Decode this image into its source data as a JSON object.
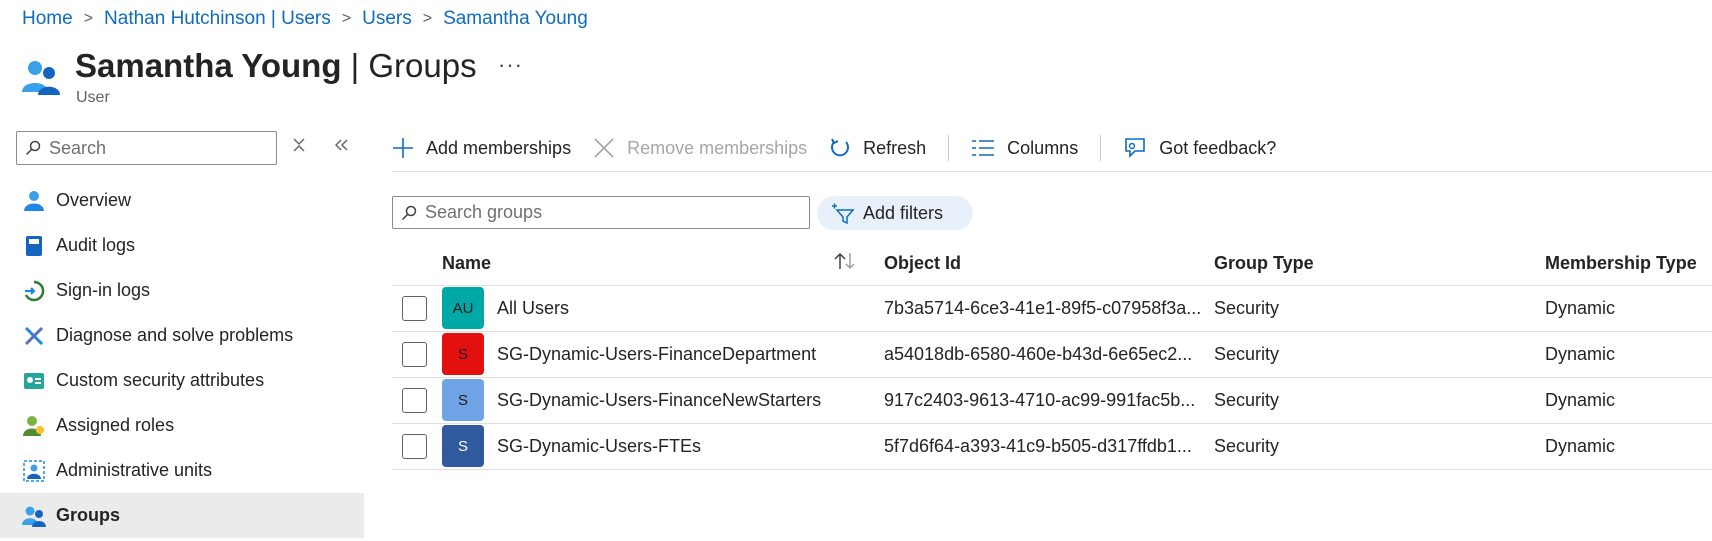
{
  "breadcrumb": [
    "Home",
    "Nathan Hutchinson | Users",
    "Users",
    "Samantha Young"
  ],
  "header": {
    "title_bold": "Samantha Young",
    "title_rest": " | Groups",
    "subtitle": "User",
    "more": "···"
  },
  "left_search": {
    "placeholder": "Search"
  },
  "nav": [
    {
      "label": "Overview",
      "icon": "user-icon"
    },
    {
      "label": "Audit logs",
      "icon": "book-icon"
    },
    {
      "label": "Sign-in logs",
      "icon": "signin-icon"
    },
    {
      "label": "Diagnose and solve problems",
      "icon": "wrench-icon"
    },
    {
      "label": "Custom security attributes",
      "icon": "badge-icon"
    },
    {
      "label": "Assigned roles",
      "icon": "roles-icon"
    },
    {
      "label": "Administrative units",
      "icon": "admin-units-icon"
    },
    {
      "label": "Groups",
      "icon": "groups-icon"
    }
  ],
  "toolbar": {
    "add": "Add memberships",
    "remove": "Remove memberships",
    "refresh": "Refresh",
    "columns": "Columns",
    "feedback": "Got feedback?"
  },
  "group_search": {
    "placeholder": "Search groups"
  },
  "add_filters": "Add filters",
  "table": {
    "columns": [
      "Name",
      "Object Id",
      "Group Type",
      "Membership Type"
    ],
    "rows": [
      {
        "initials": "AU",
        "color": "#00a9a5",
        "name": "All Users",
        "object_id": "7b3a5714-6ce3-41e1-89f5-c07958f3a...",
        "group_type": "Security",
        "membership_type": "Dynamic"
      },
      {
        "initials": "S",
        "color": "#e3100f",
        "name": "SG-Dynamic-Users-FinanceDepartment",
        "object_id": "a54018db-6580-460e-b43d-6e65ec2...",
        "group_type": "Security",
        "membership_type": "Dynamic"
      },
      {
        "initials": "S",
        "color": "#6fa3e6",
        "name": "SG-Dynamic-Users-FinanceNewStarters",
        "object_id": "917c2403-9613-4710-ac99-991fac5b...",
        "group_type": "Security",
        "membership_type": "Dynamic"
      },
      {
        "initials": "S",
        "color": "#2f5a9e",
        "name": "SG-Dynamic-Users-FTEs",
        "object_id": "5f7d6f64-a393-41c9-b505-d317ffdb1...",
        "group_type": "Security",
        "membership_type": "Dynamic"
      }
    ]
  },
  "colors": {
    "accent": "#0f6cbd",
    "active_nav": "#ebebeb"
  }
}
